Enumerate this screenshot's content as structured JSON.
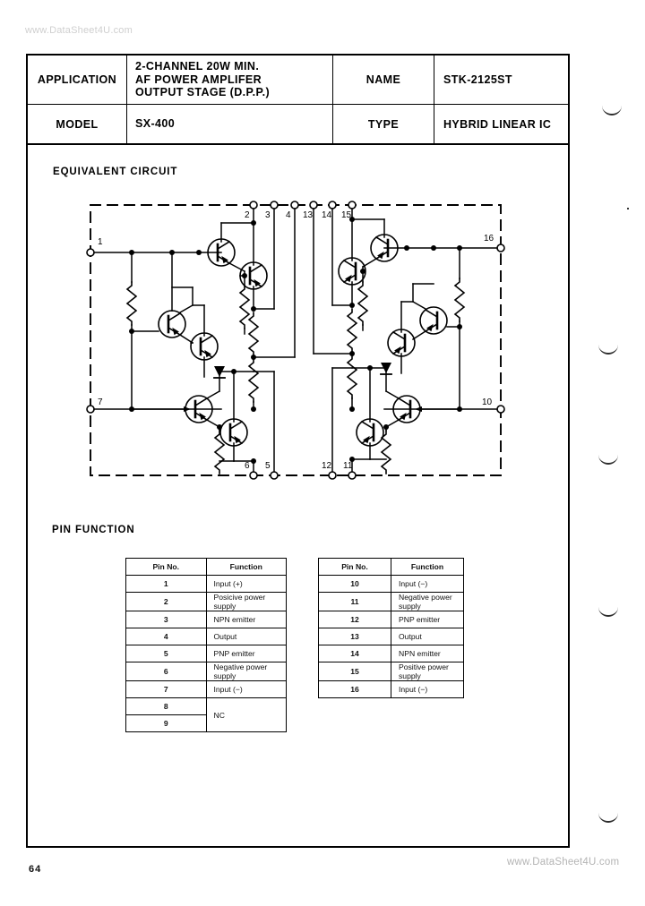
{
  "watermark": {
    "top": "www.DataSheet4U.com",
    "bottom": "www.DataSheet4U.com"
  },
  "page_number": "64",
  "header": {
    "application_label": "APPLICATION",
    "application_value_lines": [
      "2-CHANNEL 20W MIN.",
      "AF  POWER  AMPLIFER",
      "OUTPUT  STAGE (D.P.P.)"
    ],
    "name_label": "NAME",
    "name_value": "STK-2125ST",
    "model_label": "MODEL",
    "model_value": "SX-400",
    "type_label": "TYPE",
    "type_value": "HYBRID  LINEAR  IC"
  },
  "sections": {
    "equivalent_circuit": "EQUIVALENT CIRCUIT",
    "pin_function": "PIN FUNCTION"
  },
  "circuit": {
    "pin_labels_top": [
      "2",
      "3",
      "4",
      "13",
      "14",
      "15"
    ],
    "pin_labels_bottom": [
      "6",
      "5",
      "12",
      "11"
    ],
    "pin_label_left_top": "1",
    "pin_label_left_bottom": "7",
    "pin_label_right_top": "16",
    "pin_label_right_bottom": "10"
  },
  "pin_table_left": {
    "headers": [
      "Pin No.",
      "Function"
    ],
    "rows": [
      {
        "no": "1",
        "fn": "Input (+)"
      },
      {
        "no": "2",
        "fn": "Posicive power supply"
      },
      {
        "no": "3",
        "fn": "NPN emitter"
      },
      {
        "no": "4",
        "fn": "Output"
      },
      {
        "no": "5",
        "fn": "PNP emitter"
      },
      {
        "no": "6",
        "fn": "Negative power supply"
      },
      {
        "no": "7",
        "fn": "Input (−)"
      },
      {
        "no": "8",
        "fn": "NC"
      },
      {
        "no": "9",
        "fn": ""
      }
    ]
  },
  "pin_table_right": {
    "headers": [
      "Pin No.",
      "Function"
    ],
    "rows": [
      {
        "no": "10",
        "fn": "Input (−)"
      },
      {
        "no": "11",
        "fn": "Negative power supply"
      },
      {
        "no": "12",
        "fn": "PNP emitter"
      },
      {
        "no": "13",
        "fn": "Output"
      },
      {
        "no": "14",
        "fn": "NPN emitter"
      },
      {
        "no": "15",
        "fn": "Positive power supply"
      },
      {
        "no": "16",
        "fn": "Input (−)"
      }
    ]
  },
  "colors": {
    "ink": "#000000",
    "paper": "#ffffff",
    "watermark": "#cfcfcf"
  }
}
